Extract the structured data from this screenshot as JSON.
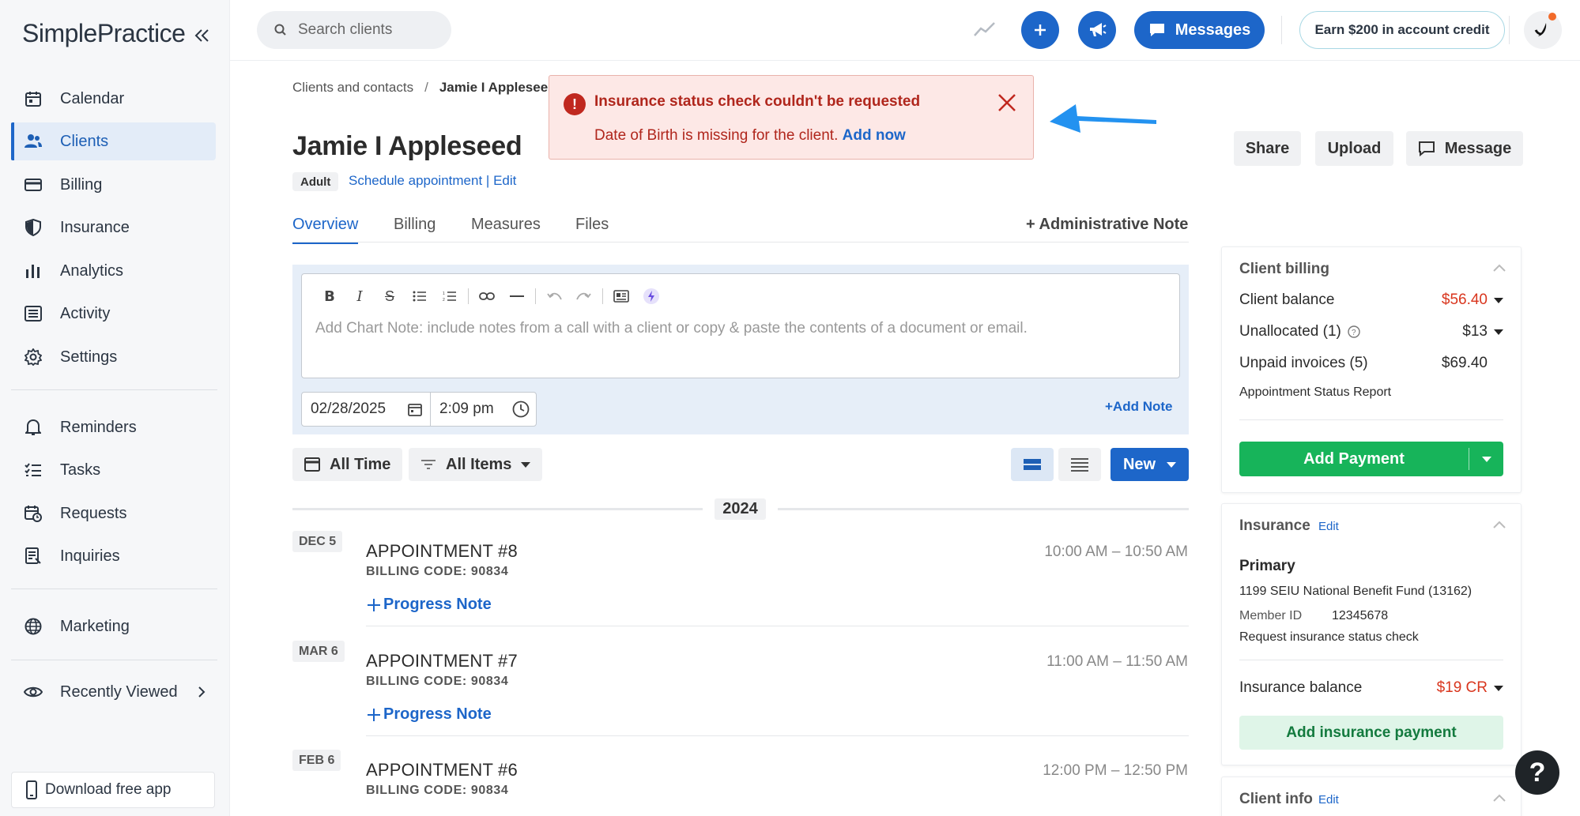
{
  "app": {
    "logo": "SimplePractice"
  },
  "sidebar": {
    "items": [
      {
        "label": "Calendar",
        "icon": "calendar-icon"
      },
      {
        "label": "Clients",
        "icon": "users-icon"
      },
      {
        "label": "Billing",
        "icon": "credit-card-icon"
      },
      {
        "label": "Insurance",
        "icon": "shield-icon"
      },
      {
        "label": "Analytics",
        "icon": "bar-chart-icon"
      },
      {
        "label": "Activity",
        "icon": "list-icon"
      },
      {
        "label": "Settings",
        "icon": "gear-icon"
      },
      {
        "label": "Reminders",
        "icon": "bell-icon"
      },
      {
        "label": "Tasks",
        "icon": "checklist-icon"
      },
      {
        "label": "Requests",
        "icon": "calendar-clock-icon"
      },
      {
        "label": "Inquiries",
        "icon": "document-icon"
      },
      {
        "label": "Marketing",
        "icon": "globe-icon"
      },
      {
        "label": "Recently Viewed",
        "icon": "eye-icon"
      }
    ],
    "download_app": "Download free app"
  },
  "topbar": {
    "search_placeholder": "Search clients",
    "messages": "Messages",
    "earn": "Earn $200 in account credit"
  },
  "breadcrumb": {
    "parent": "Clients and contacts",
    "sep": "/",
    "current": "Jamie I Applesee"
  },
  "client": {
    "name": "Jamie I Appleseed",
    "badge": "Adult",
    "schedule": "Schedule appointment",
    "pipe": " | ",
    "edit": "Edit"
  },
  "tabs": [
    "Overview",
    "Billing",
    "Measures",
    "Files"
  ],
  "admin_note": "+ Administrative Note",
  "editor": {
    "placeholder": "Add Chart Note: include notes from a call with a client or copy & paste the contents of a document or email.",
    "date": "02/28/2025",
    "time": "2:09 pm",
    "add_note": "+Add Note"
  },
  "filters": {
    "time": "All Time",
    "items": "All Items",
    "new": "New"
  },
  "year": "2024",
  "appointments": [
    {
      "date": "DEC 5",
      "title": "APPOINTMENT #8",
      "code": "BILLING CODE: 90834",
      "time": "10:00 AM – 10:50 AM",
      "note": "Progress Note"
    },
    {
      "date": "MAR 6",
      "title": "APPOINTMENT #7",
      "code": "BILLING CODE: 90834",
      "time": "11:00 AM – 11:50 AM",
      "note": "Progress Note"
    },
    {
      "date": "FEB 6",
      "title": "APPOINTMENT #6",
      "code": "BILLING CODE: 90834",
      "time": "12:00 PM – 12:50 PM"
    }
  ],
  "alert": {
    "title": "Insurance status check couldn't be requested",
    "message": "Date of Birth is missing for the client.",
    "link": "Add now"
  },
  "actions": {
    "share": "Share",
    "upload": "Upload",
    "message": "Message"
  },
  "billing": {
    "title": "Client billing",
    "balance_label": "Client balance",
    "balance_value": "$56.40",
    "unallocated_label": "Unallocated (1)",
    "unallocated_value": "$13",
    "unpaid_label": "Unpaid invoices (5)",
    "unpaid_value": "$69.40",
    "report": "Appointment Status Report",
    "add_payment": "Add Payment"
  },
  "insurance": {
    "title": "Insurance",
    "edit": "Edit",
    "primary": "Primary",
    "plan": "1199 SEIU National Benefit Fund",
    "plan_code": "(13162)",
    "member_label": "Member ID",
    "member_id": "12345678",
    "request": "Request insurance status check",
    "balance_label": "Insurance balance",
    "balance_value": "$19 CR",
    "add_payment": "Add insurance payment"
  },
  "client_info": {
    "title": "Client info",
    "edit": "Edit"
  },
  "help": "?"
}
